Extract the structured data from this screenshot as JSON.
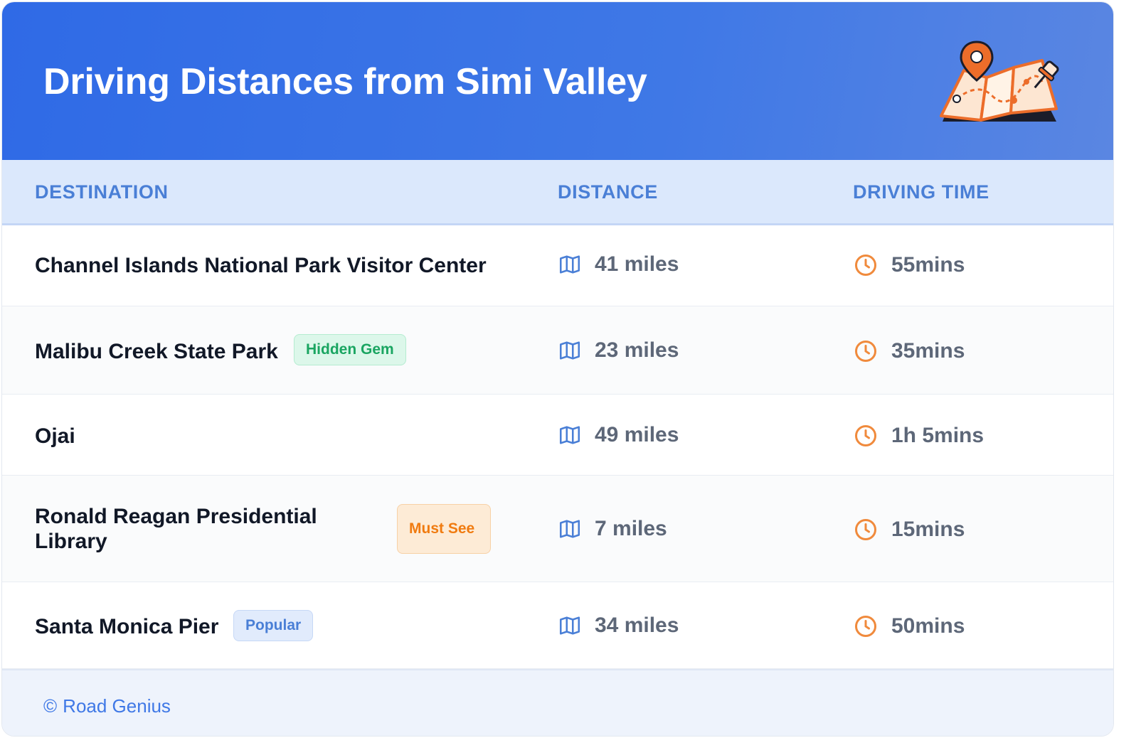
{
  "header": {
    "title": "Driving Distances from Simi Valley",
    "illustration_icon": "map-with-pins-icon"
  },
  "columns": {
    "destination": "DESTINATION",
    "distance": "DISTANCE",
    "driving_time": "DRIVING TIME"
  },
  "rows": [
    {
      "destination": "Channel Islands National Park Visitor Center",
      "badge": null,
      "distance": "41 miles",
      "time": "55mins"
    },
    {
      "destination": "Malibu Creek State Park",
      "badge": "Hidden Gem",
      "badge_color": "#1aa561",
      "distance": "23 miles",
      "time": "35mins"
    },
    {
      "destination": "Ojai",
      "badge": null,
      "distance": "49 miles",
      "time": "1h 5mins"
    },
    {
      "destination": "Ronald Reagan Presidential Library",
      "badge": "Must See",
      "badge_color": "#f07b10",
      "distance": "7 miles",
      "time": "15mins"
    },
    {
      "destination": "Santa Monica Pier",
      "badge": "Popular",
      "badge_color": "#4a7fd6",
      "distance": "34 miles",
      "time": "50mins"
    }
  ],
  "icons": {
    "distance": "map-icon",
    "time": "clock-icon"
  },
  "footer": {
    "copyright_symbol": "©",
    "brand": "Road Genius"
  },
  "colors": {
    "header_bg": "#2f6ae6",
    "accent_blue": "#4a7fd6",
    "accent_orange": "#f08a3c",
    "hidden_gem": "#1aa561",
    "must_see": "#f07b10"
  }
}
